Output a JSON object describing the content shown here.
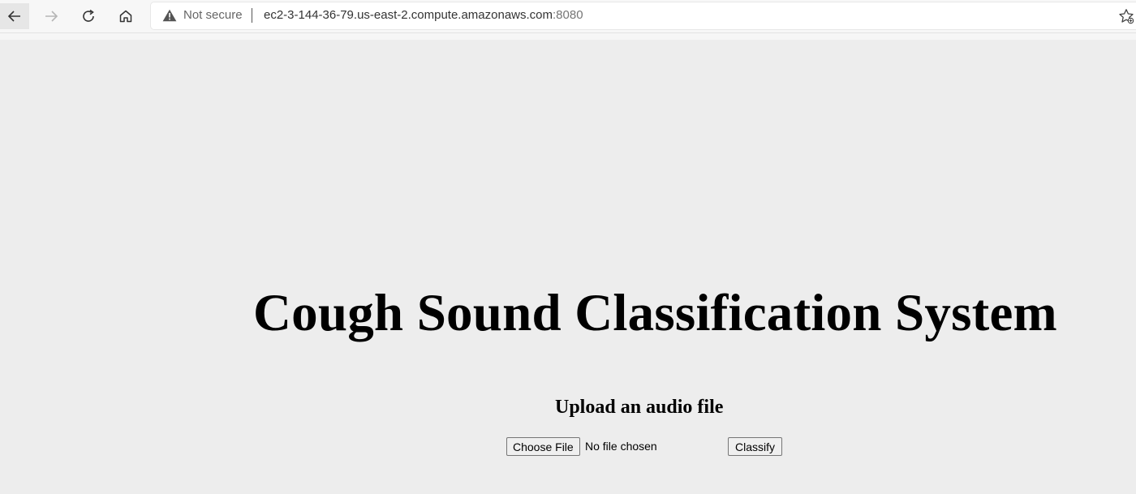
{
  "browser": {
    "security_label": "Not secure",
    "url_host": "ec2-3-144-36-79.us-east-2.compute.amazonaws.com",
    "url_port": ":8080",
    "icons": {
      "back": "back-arrow-icon",
      "forward": "forward-arrow-icon",
      "reload": "reload-icon",
      "home": "home-icon",
      "warning": "warning-triangle-icon",
      "favorite": "favorite-star-icon"
    }
  },
  "page": {
    "title": "Cough Sound Classification System",
    "upload_heading": "Upload an audio file",
    "file_input": {
      "button_label": "Choose File",
      "status_text": "No file chosen"
    },
    "classify_label": "Classify",
    "background_color": "#ededed"
  }
}
